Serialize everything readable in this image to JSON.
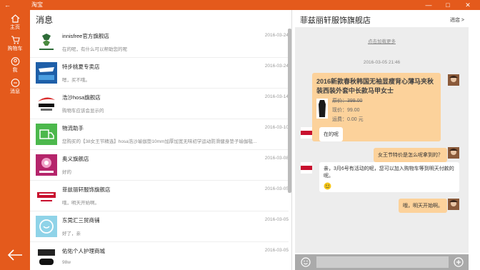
{
  "app": {
    "title": "淘宝",
    "accent": "#e45a1c"
  },
  "window_controls": {
    "minimize": "—",
    "maximize": "□",
    "close": "✕"
  },
  "sidebar": {
    "items": [
      {
        "label": "主页",
        "icon": "home-icon"
      },
      {
        "label": "购物车",
        "icon": "cart-icon"
      },
      {
        "label": "我",
        "icon": "user-icon"
      },
      {
        "label": "消息",
        "icon": "message-icon"
      }
    ],
    "back_icon": "arrow-left-icon"
  },
  "messages": {
    "header": "消息",
    "items": [
      {
        "name": "innisfree官方旗舰店",
        "preview": "在的呢，有什么可以帮助您的呢",
        "date": "2016-03-24"
      },
      {
        "name": "特步桃夏专卖店",
        "preview": "嗯，买不哦。",
        "date": "2016-03-24"
      },
      {
        "name": "浩沙hosa旗舰店",
        "preview": "购物车应该会显示的",
        "date": "2016-03-14"
      },
      {
        "name": "物流助手",
        "preview": "您购买的【38女王节精选】hosa浩沙瑜伽垫10mm加厚加宽无味初学运动防滑健身垫子瑜伽毯...",
        "date": "2016-03-10"
      },
      {
        "name": "奥义旗舰店",
        "preview": "好的",
        "date": "2016-03-08"
      },
      {
        "name": "菲兹丽轩服饰旗舰店",
        "preview": "哦，明天开始啊。",
        "date": "2016-03-05"
      },
      {
        "name": "东莞汇三贸商铺",
        "preview": "好了，亲",
        "date": "2016-03-05"
      },
      {
        "name": "佑佑个人护理商城",
        "preview": "98w",
        "date": "2016-03-05"
      }
    ]
  },
  "chat": {
    "shop_name": "菲兹丽轩服饰旗舰店",
    "enter_shop": "进店 >",
    "load_more": "点击加载更多",
    "timestamp": "2016-03-05 21:46",
    "product_card": {
      "title": "2016新款春秋韩国无袖显瘦背心薄马夹秋装西装外套中长款马甲女士",
      "original_price": "原价：399.00",
      "current_price": "现价：99.00",
      "shipping": "运费：0.00 元"
    },
    "messages": [
      {
        "side": "left",
        "text": "在的呢"
      },
      {
        "side": "right",
        "text": "女王节特价是怎么呢拿到的？"
      },
      {
        "side": "left",
        "text": "亲，3月6号有活动的呢，您可以加入购物车等到明天付款的呢。"
      },
      {
        "side": "right",
        "text": "哦，明天开始啊。"
      }
    ],
    "emoji_icon": "smile-icon",
    "plus_icon": "plus-icon"
  }
}
